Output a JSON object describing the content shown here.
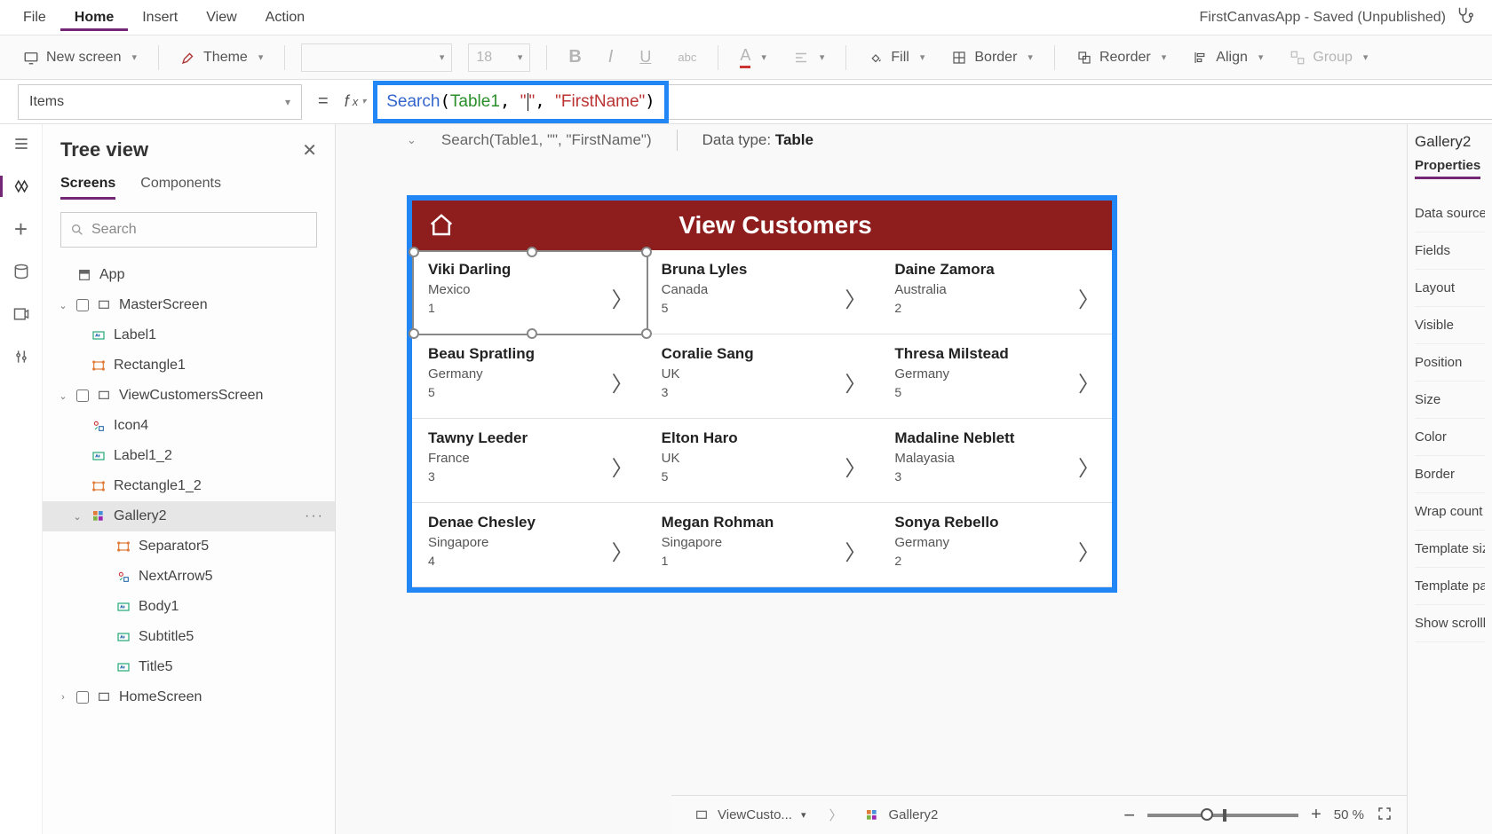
{
  "titlebar": {
    "doc": "FirstCanvasApp - Saved (Unpublished)"
  },
  "menu": {
    "file": "File",
    "home": "Home",
    "insert": "Insert",
    "view": "View",
    "action": "Action"
  },
  "ribbon": {
    "newScreen": "New screen",
    "theme": "Theme",
    "fontSize": "18",
    "fill": "Fill",
    "border": "Border",
    "reorder": "Reorder",
    "align": "Align",
    "group": "Group"
  },
  "formula": {
    "property": "Items",
    "fn": "Search",
    "table": "Table1",
    "arg2_prefix": "",
    "arg2_suffix": "",
    "arg3": "\"FirstName\"",
    "hintText": "Search(Table1, \"\", \"FirstName\")",
    "dataTypeLabel": "Data type: ",
    "dataTypeValue": "Table"
  },
  "tree": {
    "title": "Tree view",
    "tabs": {
      "screens": "Screens",
      "components": "Components"
    },
    "searchPlaceholder": "Search",
    "items": [
      {
        "label": "App",
        "depth": 0,
        "expand": "",
        "icon": "app"
      },
      {
        "label": "MasterScreen",
        "depth": 0,
        "expand": "v",
        "icon": "screen"
      },
      {
        "label": "Label1",
        "depth": 1,
        "expand": "",
        "icon": "label"
      },
      {
        "label": "Rectangle1",
        "depth": 1,
        "expand": "",
        "icon": "rect"
      },
      {
        "label": "ViewCustomersScreen",
        "depth": 0,
        "expand": "v",
        "icon": "screen"
      },
      {
        "label": "Icon4",
        "depth": 1,
        "expand": "",
        "icon": "iconctrl"
      },
      {
        "label": "Label1_2",
        "depth": 1,
        "expand": "",
        "icon": "label"
      },
      {
        "label": "Rectangle1_2",
        "depth": 1,
        "expand": "",
        "icon": "rect"
      },
      {
        "label": "Gallery2",
        "depth": 1,
        "expand": "v",
        "icon": "gallery",
        "selected": true,
        "more": true
      },
      {
        "label": "Separator5",
        "depth": 2,
        "expand": "",
        "icon": "rect"
      },
      {
        "label": "NextArrow5",
        "depth": 2,
        "expand": "",
        "icon": "iconctrl"
      },
      {
        "label": "Body1",
        "depth": 2,
        "expand": "",
        "icon": "label"
      },
      {
        "label": "Subtitle5",
        "depth": 2,
        "expand": "",
        "icon": "label"
      },
      {
        "label": "Title5",
        "depth": 2,
        "expand": "",
        "icon": "label"
      },
      {
        "label": "HomeScreen",
        "depth": 0,
        "expand": ">",
        "icon": "screen"
      }
    ]
  },
  "preview": {
    "headerTitle": "View Customers",
    "customers": [
      {
        "name": "Viki  Darling",
        "country": "Mexico",
        "num": "1"
      },
      {
        "name": "Bruna  Lyles",
        "country": "Canada",
        "num": "5"
      },
      {
        "name": "Daine  Zamora",
        "country": "Australia",
        "num": "2"
      },
      {
        "name": "Beau  Spratling",
        "country": "Germany",
        "num": "5"
      },
      {
        "name": "Coralie  Sang",
        "country": "UK",
        "num": "3"
      },
      {
        "name": "Thresa  Milstead",
        "country": "Germany",
        "num": "5"
      },
      {
        "name": "Tawny  Leeder",
        "country": "France",
        "num": "3"
      },
      {
        "name": "Elton  Haro",
        "country": "UK",
        "num": "5"
      },
      {
        "name": "Madaline  Neblett",
        "country": "Malayasia",
        "num": "3"
      },
      {
        "name": "Denae  Chesley",
        "country": "Singapore",
        "num": "4"
      },
      {
        "name": "Megan  Rohman",
        "country": "Singapore",
        "num": "1"
      },
      {
        "name": "Sonya  Rebello",
        "country": "Germany",
        "num": "2"
      }
    ]
  },
  "rightPanel": {
    "object": "Gallery2",
    "tab": "Properties",
    "rows": [
      "Data source",
      "Fields",
      "Layout",
      "Visible",
      "Position",
      "Size",
      "Color",
      "Border",
      "Wrap count",
      "Template size",
      "Template padding",
      "Show scrollbar"
    ]
  },
  "status": {
    "breadcrumb1": "ViewCusto...",
    "breadcrumb2": "Gallery2",
    "zoomPercent": "50  %"
  }
}
